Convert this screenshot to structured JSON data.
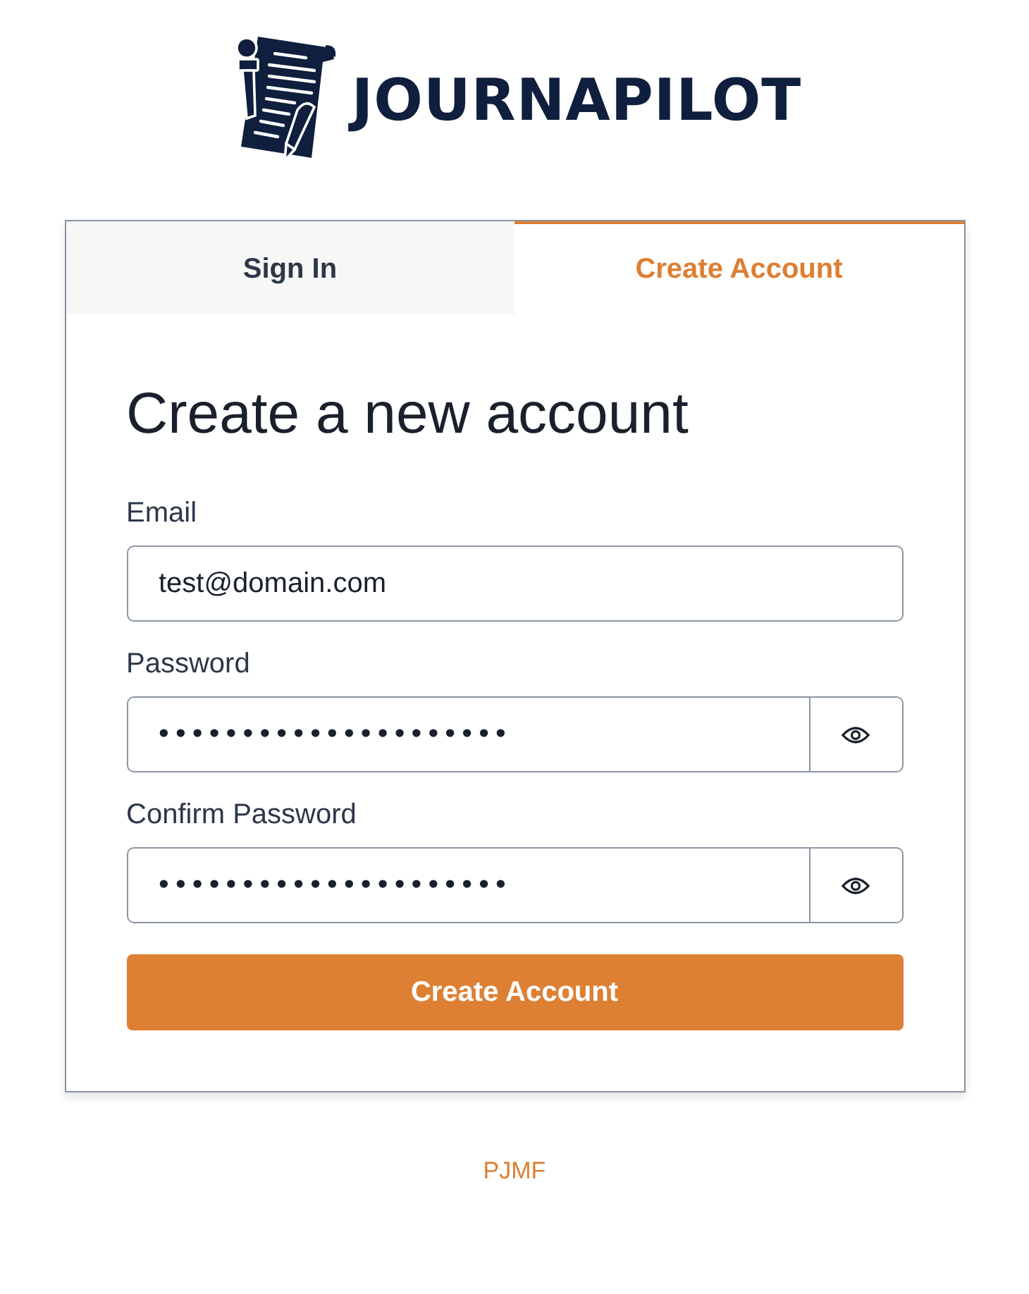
{
  "logo": {
    "text": "JOURNAPILOT"
  },
  "tabs": [
    {
      "label": "Sign In",
      "selected": false
    },
    {
      "label": "Create Account",
      "selected": true
    }
  ],
  "form": {
    "heading": "Create a new account",
    "fields": [
      {
        "kind": "text",
        "label": "Email",
        "value": "test@domain.com"
      },
      {
        "kind": "password",
        "label": "Password",
        "value": "•••••••••••••••••••••"
      },
      {
        "kind": "password",
        "label": "Confirm Password",
        "value": "•••••••••••••••••••••"
      }
    ],
    "submit": "Create Account"
  },
  "footer": {
    "text": "PJMF"
  }
}
